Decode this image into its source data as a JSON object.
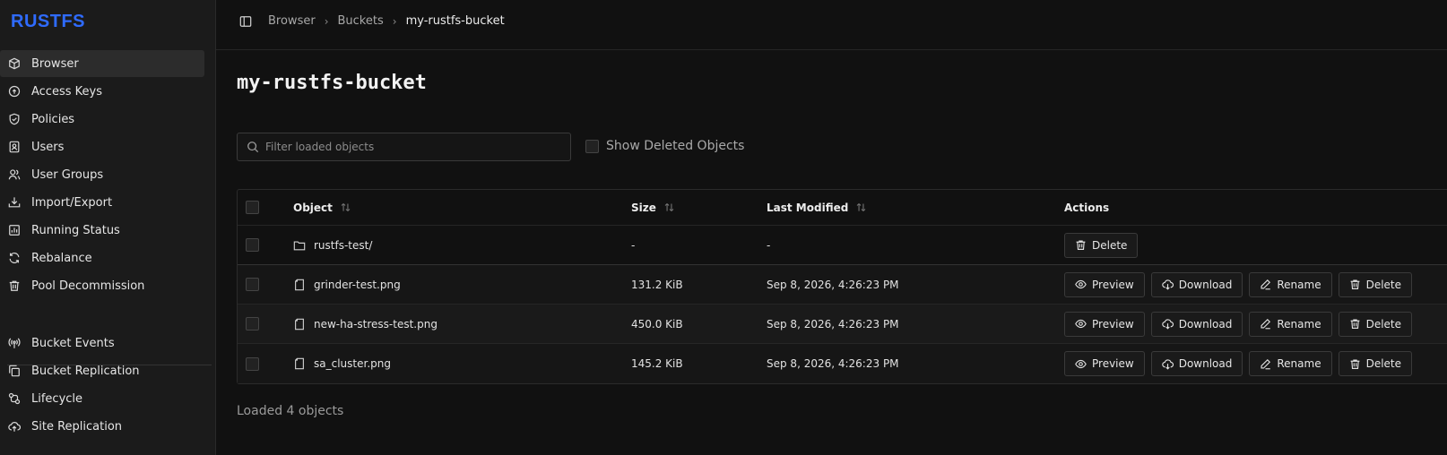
{
  "app": {
    "logo": "RUSTFS"
  },
  "sidebar": {
    "items": [
      {
        "label": "Browser",
        "icon": "box-icon",
        "active": true
      },
      {
        "label": "Access Keys",
        "icon": "key-icon"
      },
      {
        "label": "Policies",
        "icon": "shield-icon"
      },
      {
        "label": "Users",
        "icon": "user-card-icon"
      },
      {
        "label": "User Groups",
        "icon": "users-icon"
      },
      {
        "label": "Import/Export",
        "icon": "download-tray-icon"
      },
      {
        "label": "Running Status",
        "icon": "bar-chart-icon"
      },
      {
        "label": "Rebalance",
        "icon": "refresh-icon"
      },
      {
        "label": "Pool Decommission",
        "icon": "trash-icon"
      }
    ],
    "items2": [
      {
        "label": "Bucket Events",
        "icon": "broadcast-icon"
      },
      {
        "label": "Bucket Replication",
        "icon": "copy-icon"
      },
      {
        "label": "Lifecycle",
        "icon": "lifecycle-icon"
      },
      {
        "label": "Site Replication",
        "icon": "cloud-upload-icon"
      }
    ]
  },
  "breadcrumb": [
    "Browser",
    "Buckets",
    "my-rustfs-bucket"
  ],
  "page": {
    "title": "my-rustfs-bucket"
  },
  "search": {
    "placeholder": "Filter loaded objects",
    "value": ""
  },
  "show_deleted": {
    "label": "Show Deleted Objects",
    "checked": false
  },
  "table": {
    "columns": {
      "object": "Object",
      "size": "Size",
      "modified": "Last Modified",
      "actions": "Actions"
    },
    "rows": [
      {
        "name": "rustfs-test/",
        "type": "folder",
        "size": "-",
        "modified": "-",
        "actions": [
          "Delete"
        ]
      },
      {
        "name": "grinder-test.png",
        "type": "file",
        "size": "131.2 KiB",
        "modified": "Sep 8, 2026, 4:26:23 PM",
        "actions": [
          "Preview",
          "Download",
          "Rename",
          "Delete"
        ]
      },
      {
        "name": "new-ha-stress-test.png",
        "type": "file",
        "size": "450.0 KiB",
        "modified": "Sep 8, 2026, 4:26:23 PM",
        "actions": [
          "Preview",
          "Download",
          "Rename",
          "Delete"
        ]
      },
      {
        "name": "sa_cluster.png",
        "type": "file",
        "size": "145.2 KiB",
        "modified": "Sep 8, 2026, 4:26:23 PM",
        "actions": [
          "Preview",
          "Download",
          "Rename",
          "Delete"
        ]
      }
    ]
  },
  "footer": {
    "status": "Loaded 4 objects"
  },
  "colors": {
    "accent": "#2f6bff",
    "background": "#111111",
    "sidebar": "#1b1b1b"
  }
}
